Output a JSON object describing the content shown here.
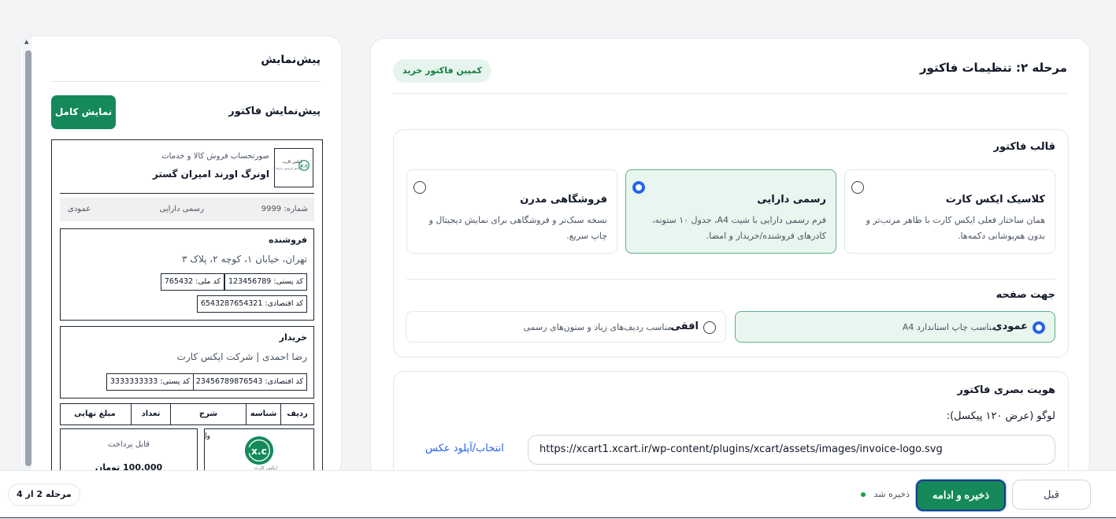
{
  "settings": {
    "step_title": "مرحله ۲: تنظیمات فاکتور",
    "campaign_badge": "کمپین فاکتور خرید",
    "template_section": {
      "title": "قالب فاکتور",
      "options": [
        {
          "name": "کلاسیک ایکس کارت",
          "desc": "همان ساختار فعلی ایکس کارت با ظاهر مرتب‌تر و بدون هم‌پوشانی دکمه‌ها.",
          "selected": false
        },
        {
          "name": "رسمی دارایی",
          "desc": "فرم رسمی دارایی با شیت A4، جدول ۱۰ ستونه، کادرهای فروشنده/خریدار و امضا.",
          "selected": true
        },
        {
          "name": "فروشگاهی مدرن",
          "desc": "نسخه سبک‌تر و فروشگاهی برای نمایش دیجیتال و چاپ سریع.",
          "selected": false
        }
      ]
    },
    "orientation_section": {
      "title": "جهت صفحه",
      "options": [
        {
          "name": "عمودی",
          "desc": "مناسب چاپ استاندارد A4",
          "selected": true
        },
        {
          "name": "افقی",
          "desc": "مناسب ردیف‌های زیاد و ستون‌های رسمی",
          "selected": false
        }
      ]
    },
    "identity_section": {
      "title": "هویت بصری فاکتور",
      "logo_label": "لوگو (عرض ۱۲۰ پیکسل):",
      "logo_url": "https://xcart1.xcart.ir/wp-content/plugins/xcart/assets/images/invoice-logo.svg",
      "upload_link": "انتخاب/آپلود عکس"
    }
  },
  "preview": {
    "title": "پیش‌نمایش",
    "subtitle": "پیش‌نمایش فاکتور",
    "full_button": "نمایش کامل",
    "invoice": {
      "logo_text_1": "ایکس کارت",
      "logo_text_2": "فاکتور فروش حرفه‌ای",
      "subtitle": "صورتحساب فروش کالا و خدمات",
      "company": "اونرگ اورند امیران گستر",
      "meta": {
        "number": "شماره: 9999",
        "type": "رسمی دارایی",
        "orientation": "عمودی"
      },
      "seller": {
        "title": "فروشنده",
        "address": "تهران، خیابان ۱، کوچه ۲، پلاک ۳",
        "postal": "کد پستی: 123456789",
        "national": "کد ملی: 765432",
        "economic": "کد اقتصادی: 6543287654321"
      },
      "buyer": {
        "title": "خریدار",
        "name": "رضا احمدی | شرکت ایکس کارت",
        "economic": "کد اقتصادی: 23456789876543",
        "postal": "کد پستی: 3333333333"
      },
      "table_headers": [
        "ردیف",
        "شناسه",
        "شرح",
        "تعداد",
        "مبلغ نهایی"
      ],
      "logo_caption": "ایکس کارت",
      "row_fragment": "ول",
      "payable_label": "قابل پرداخت",
      "payable_amount": "100,000 تومان"
    }
  },
  "footer": {
    "prev_button": "قبل",
    "save_button": "ذخیره و ادامه",
    "saved_status": "ذخیره شد",
    "step_counter": "مرحله 2 از 4"
  },
  "colors": {
    "accent_green": "#15895a",
    "selected_bg": "#e9f5ef",
    "radio_blue": "#2563eb",
    "saved_dot": "#16a34a"
  }
}
